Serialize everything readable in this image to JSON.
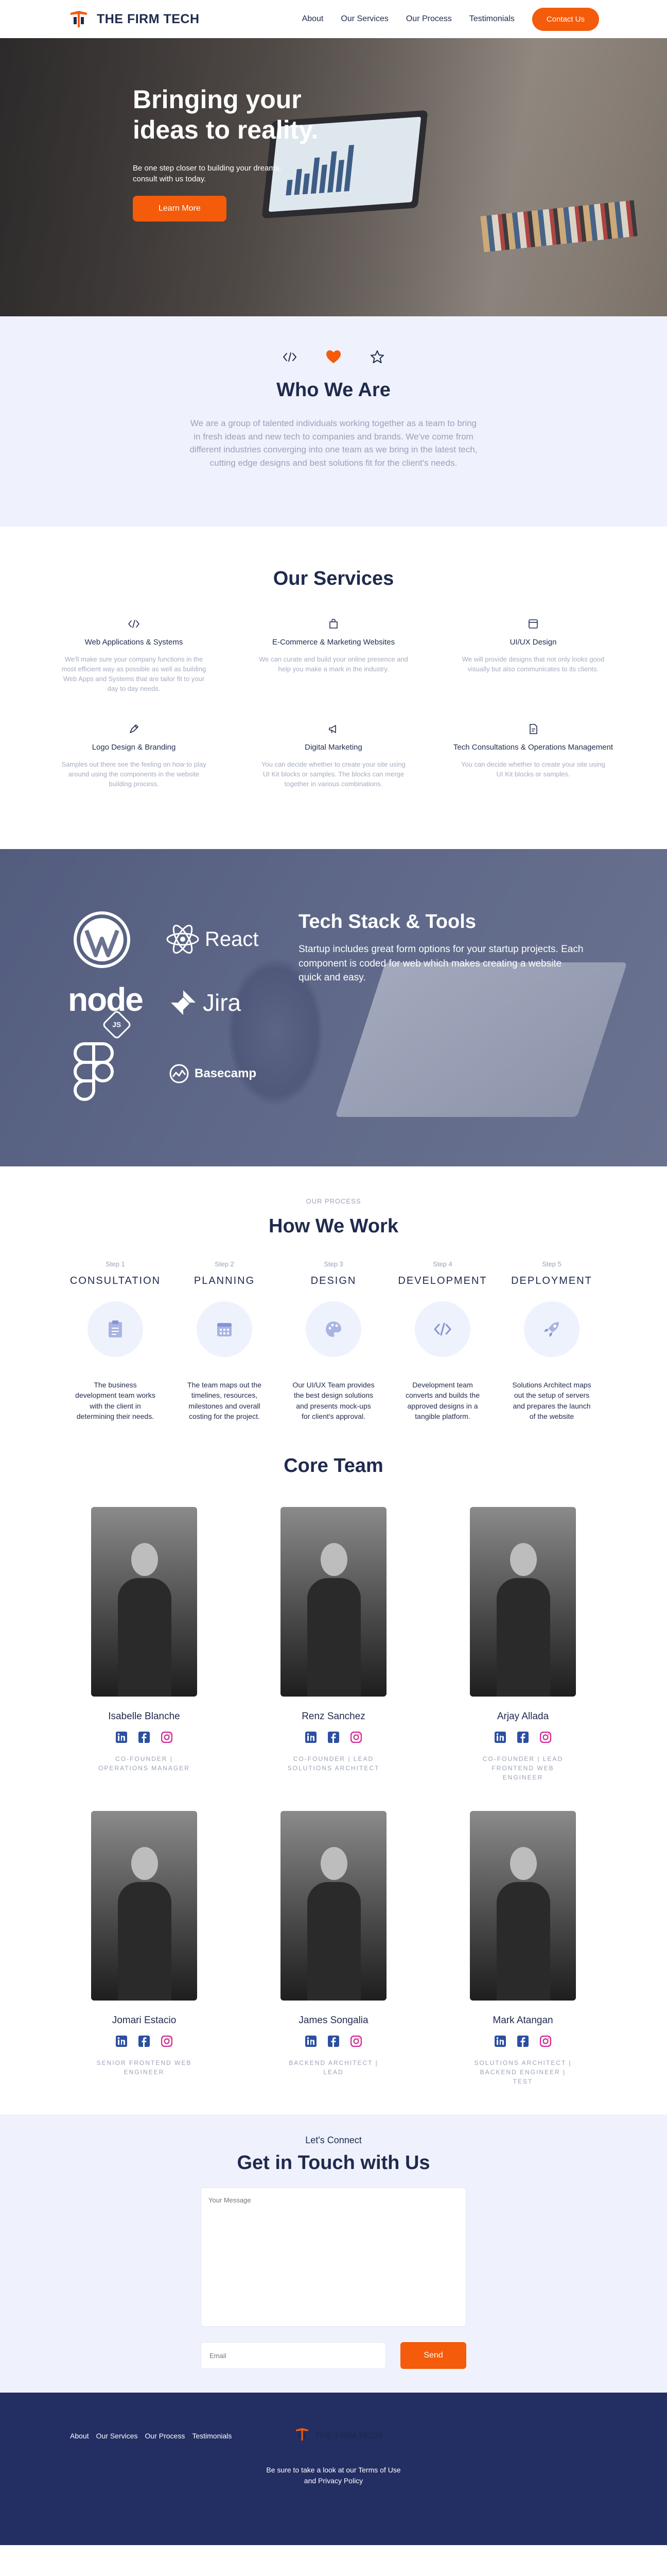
{
  "brand": {
    "name": "THE FIRM TECH",
    "accent": "#f45b0a",
    "navy": "#1f2a4d",
    "footer_bg": "#232e63"
  },
  "nav": {
    "links": [
      "About",
      "Our Services",
      "Our Process",
      "Testimonials"
    ],
    "cta": "Contact Us"
  },
  "hero": {
    "title": "Bringing your ideas to reality.",
    "subtitle": "Be one step closer to building your dreams, consult with us today.",
    "button": "Learn More"
  },
  "who": {
    "icons": [
      "code-icon",
      "heart-icon",
      "star-icon"
    ],
    "title": "Who We Are",
    "text": "We are a group of talented individuals working together as a team to bring in fresh ideas and new tech to companies and brands. We've come from different industries converging into one team as we bring in the latest tech, cutting edge designs and best solutions fit for the client's needs."
  },
  "services": {
    "title": "Our Services",
    "items": [
      {
        "icon": "code-icon",
        "title": "Web Applications & Systems",
        "text": "We'll make sure your company functions in the most efficient way as possible as well as building Web Apps and Systems that are tailor fit to your day to day needs."
      },
      {
        "icon": "shopping-bag-icon",
        "title": "E-Commerce & Marketing Websites",
        "text": "We can curate and build your online presence and help you make a mark in the industry."
      },
      {
        "icon": "browser-icon",
        "title": "UI/UX Design",
        "text": "We will provide designs that not only looks good visually but also communicates to its clients."
      },
      {
        "icon": "pen-icon",
        "title": "Logo Design & Branding",
        "text": "Samples out there see the feeling on how to play around using the components in the website building process."
      },
      {
        "icon": "megaphone-icon",
        "title": "Digital Marketing",
        "text": "You can decide whether to create your site using UI Kit blocks or samples. The blocks can merge together in various combinations."
      },
      {
        "icon": "document-icon",
        "title": "Tech Consultations & Operations Management",
        "text": "You can decide whether to create your site using UI Kit blocks or samples."
      }
    ]
  },
  "tech": {
    "title": "Tech Stack & Tools",
    "text": "Startup includes great form options for your startup projects. Each component is coded for web which makes creating a website quick and easy.",
    "logos": {
      "react": "React",
      "jira": "Jira",
      "basecamp": "Basecamp",
      "node": "node",
      "js": "JS"
    }
  },
  "process": {
    "eyebrow": "OUR PROCESS",
    "title": "How We Work",
    "steps": [
      {
        "num": "Step 1",
        "name": "CONSULTATION",
        "icon": "clipboard-icon",
        "text": "The business development team works with the client in determining their needs."
      },
      {
        "num": "Step 2",
        "name": "PLANNING",
        "icon": "calendar-icon",
        "text": "The team maps out the timelines, resources, milestones and overall costing for the project."
      },
      {
        "num": "Step 3",
        "name": "DESIGN",
        "icon": "palette-icon",
        "text": "Our UI/UX Team provides the best design solutions and presents mock-ups for client's approval."
      },
      {
        "num": "Step 4",
        "name": "DEVELOPMENT",
        "icon": "code-icon",
        "text": "Development team converts and builds the approved designs in a tangible platform."
      },
      {
        "num": "Step 5",
        "name": "DEPLOYMENT",
        "icon": "rocket-icon",
        "text": "Solutions Architect maps out the setup of servers and prepares the launch of the website"
      }
    ]
  },
  "team": {
    "title": "Core Team",
    "members": [
      {
        "name": "Isabelle Blanche",
        "role": "CO-FOUNDER | OPERATIONS MANAGER"
      },
      {
        "name": "Renz Sanchez",
        "role": "CO-FOUNDER | LEAD SOLUTIONS ARCHITECT"
      },
      {
        "name": "Arjay Allada",
        "role": "CO-FOUNDER | LEAD FRONTEND WEB ENGINEER"
      },
      {
        "name": "Jomari Estacio",
        "role": "SENIOR FRONTEND WEB ENGINEER"
      },
      {
        "name": "James Songalia",
        "role": "BACKEND ARCHITECT | LEAD"
      },
      {
        "name": "Mark Atangan",
        "role": "SOLUTIONS ARCHITECT | BACKEND ENGINEER | TEST"
      }
    ]
  },
  "contact": {
    "eyebrow": "Let's Connect",
    "title": "Get in Touch with Us",
    "message_placeholder": "Your Message",
    "email_placeholder": "Email",
    "send": "Send"
  },
  "footer": {
    "links": [
      "About",
      "Our Services",
      "Our Process",
      "Testimonials"
    ],
    "brand": "THE FIRM TECH",
    "note": "Be sure to take a look at our Terms of Use and Privacy Policy"
  }
}
